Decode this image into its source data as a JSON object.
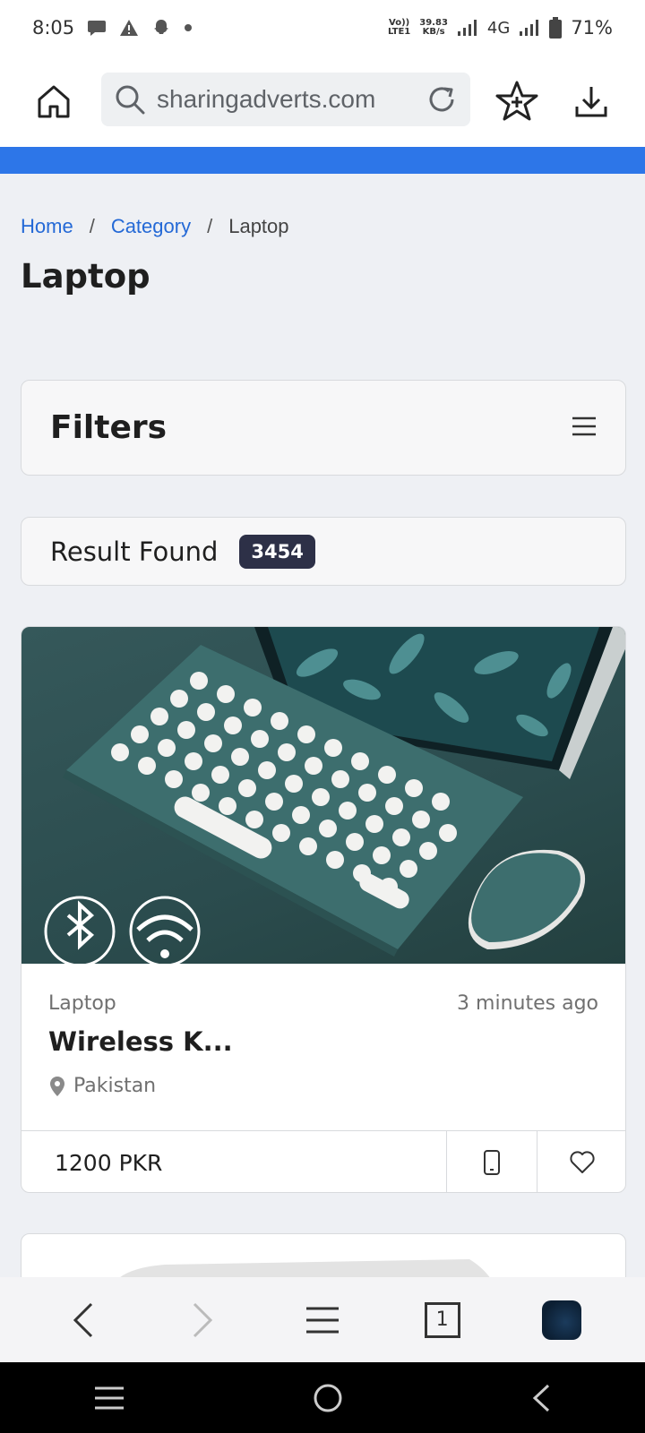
{
  "status_bar": {
    "time": "8:05",
    "net_top": "Vo))",
    "net_bottom": "LTE1",
    "speed_value": "39.83",
    "speed_unit": "KB/s",
    "network_type": "4G",
    "battery": "71%"
  },
  "browser": {
    "url": "sharingadverts.com",
    "accent_color": "#2d76e8"
  },
  "breadcrumb": {
    "items": [
      "Home",
      "Category",
      "Laptop"
    ],
    "separator": "/"
  },
  "page": {
    "title": "Laptop"
  },
  "filters": {
    "title": "Filters"
  },
  "results": {
    "label": "Result Found",
    "count": "3454"
  },
  "listing": {
    "category": "Laptop",
    "time": "3 minutes ago",
    "title": "Wireless K...",
    "location": "Pakistan",
    "price": "1200 PKR"
  },
  "bottom_nav": {
    "tab_count": "1"
  },
  "icons": {
    "home": "home-icon",
    "search": "search-icon",
    "reload": "reload-icon",
    "bookmark": "star-add-icon",
    "download": "download-icon",
    "menu": "hamburger-icon",
    "phone": "phone-icon",
    "favorite": "heart-icon",
    "location": "location-pin-icon"
  }
}
